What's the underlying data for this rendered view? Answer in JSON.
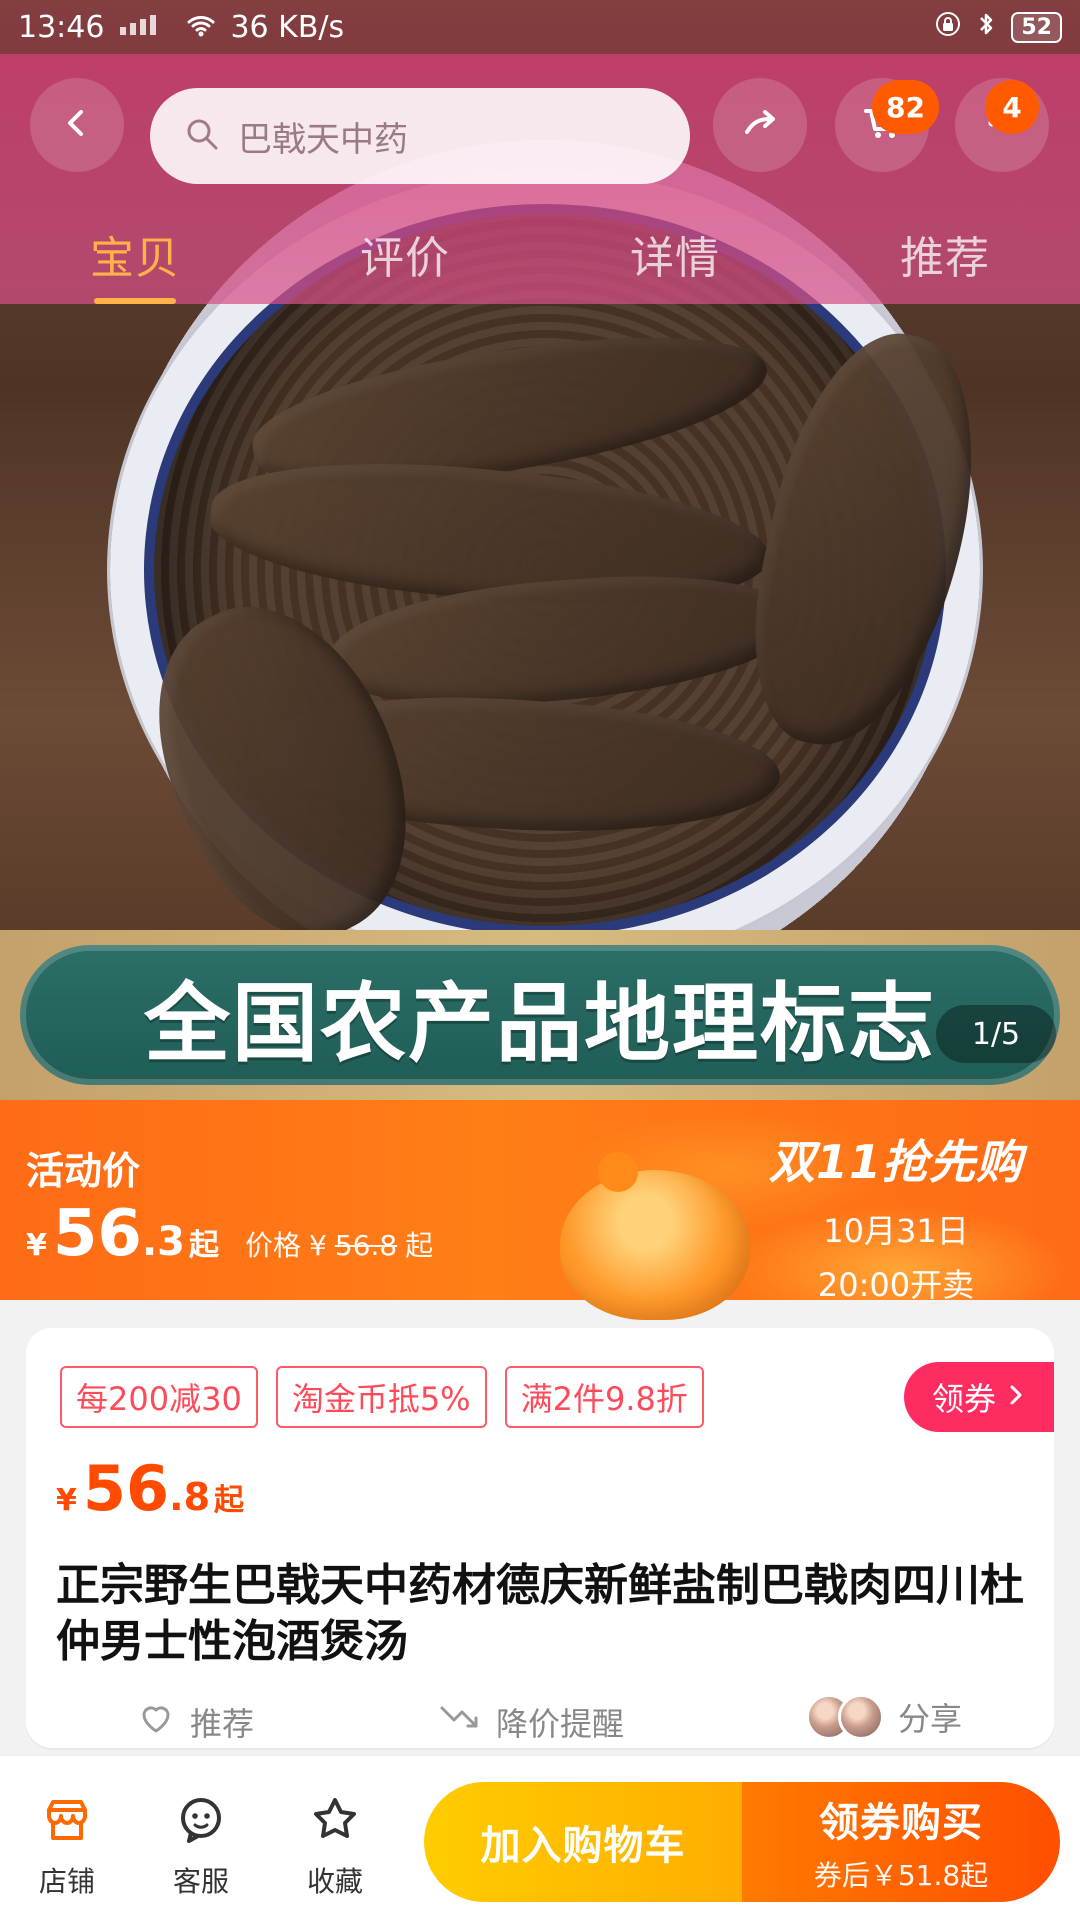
{
  "status_bar": {
    "time": "13:46",
    "network_speed": "36 KB/s",
    "battery": "52"
  },
  "top_nav": {
    "search_placeholder": "巴戟天中药",
    "cart_badge": "82",
    "more_badge": "4",
    "tabs": [
      "宝贝",
      "评价",
      "详情",
      "推荐"
    ],
    "active_tab_index": 0
  },
  "hero": {
    "banner_text": "全国农产品地理标志",
    "image_counter": "1/5"
  },
  "promo": {
    "label": "活动价",
    "price_currency": "¥",
    "price_int": "56",
    "price_dec": ".3",
    "price_suffix": "起",
    "orig_label": "价格",
    "orig_currency": "¥",
    "orig_value": "56.8",
    "orig_suffix": "起",
    "event_title": "双11抢先购",
    "event_date": "10月31日",
    "event_time": "20:00开卖"
  },
  "product": {
    "tags": [
      "每200减30",
      "淘金币抵5%",
      "满2件9.8折"
    ],
    "coupon_button": "领券",
    "price_currency": "¥",
    "price_int": "56",
    "price_dec": ".8",
    "price_suffix": "起",
    "title": "正宗野生巴戟天中药材德庆新鲜盐制巴戟肉四川杜仲男士性泡酒煲汤",
    "actions": {
      "recommend": "推荐",
      "price_alert": "降价提醒",
      "share": "分享"
    }
  },
  "bottom_bar": {
    "store": "店铺",
    "service": "客服",
    "favorite": "收藏",
    "add_to_cart": "加入购物车",
    "buy_main": "领券购买",
    "buy_sub": "券后￥51.8起"
  }
}
